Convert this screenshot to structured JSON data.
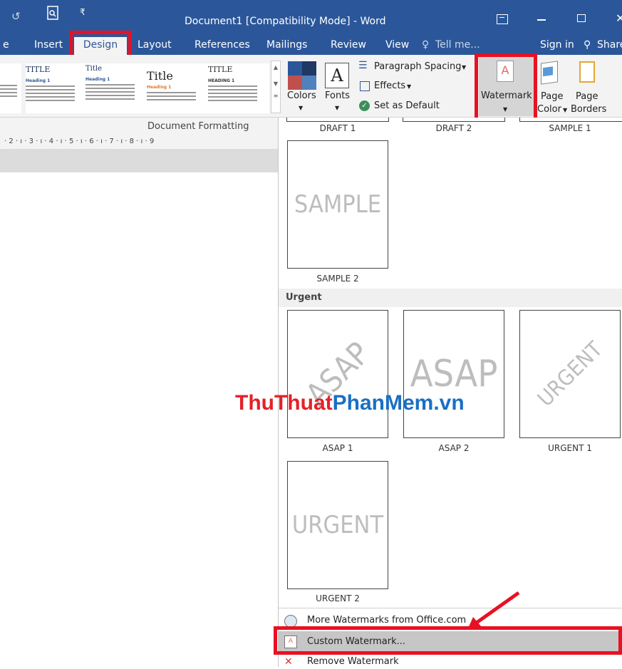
{
  "titlebar": {
    "title": "Document1 [Compatibility Mode] - Word"
  },
  "tabs": [
    {
      "label": "e"
    },
    {
      "label": "Insert"
    },
    {
      "label": "Design"
    },
    {
      "label": "Layout"
    },
    {
      "label": "References"
    },
    {
      "label": "Mailings"
    },
    {
      "label": "Review"
    },
    {
      "label": "View"
    },
    {
      "label": "Tell me..."
    }
  ],
  "account": {
    "sign_in": "Sign in",
    "share": "Share"
  },
  "ribbon": {
    "gallery": [
      {
        "title": "TITLE",
        "heading": "Heading 1"
      },
      {
        "title": "Title",
        "heading": "Heading 1"
      },
      {
        "title": "Title",
        "heading": "Heading 1"
      },
      {
        "title": "TITLE",
        "heading": "HEADING 1"
      }
    ],
    "colors": "Colors",
    "fonts": "Fonts",
    "fonts_glyph": "A",
    "paragraph_spacing": "Paragraph Spacing",
    "effects": "Effects",
    "set_as_default": "Set as Default",
    "watermark": "Watermark",
    "page_color_1": "Page",
    "page_color_2": "Color",
    "page_borders_1": "Page",
    "page_borders_2": "Borders",
    "group_label": "Document Formatting"
  },
  "ruler": "· 2 · ı · 3 · ı · 4 · ı · 5 · ı · 6 · ı · 7 · ı · 8 · ı · 9",
  "dropdown": {
    "top_captions": [
      "DRAFT 1",
      "DRAFT 2",
      "SAMPLE 1"
    ],
    "sample2": {
      "text": "SAMPLE",
      "caption": "SAMPLE 2"
    },
    "urgent_section": "Urgent",
    "asap1": {
      "text": "ASAP",
      "caption": "ASAP 1"
    },
    "asap2": {
      "text": "ASAP",
      "caption": "ASAP 2"
    },
    "urgent1": {
      "text": "URGENT",
      "caption": "URGENT 1"
    },
    "urgent2": {
      "text": "URGENT",
      "caption": "URGENT 2"
    },
    "more": "More Watermarks from Office.com",
    "custom": "Custom Watermark...",
    "remove": "Remove Watermark"
  },
  "brand": {
    "part1": "ThuThuat",
    "part2": "PhanMem",
    "part3": ".vn"
  },
  "colors": {
    "word_blue": "#2b579a",
    "highlight_red": "#e81123",
    "brand_red": "#e32227",
    "brand_blue": "#1a6fc4"
  }
}
